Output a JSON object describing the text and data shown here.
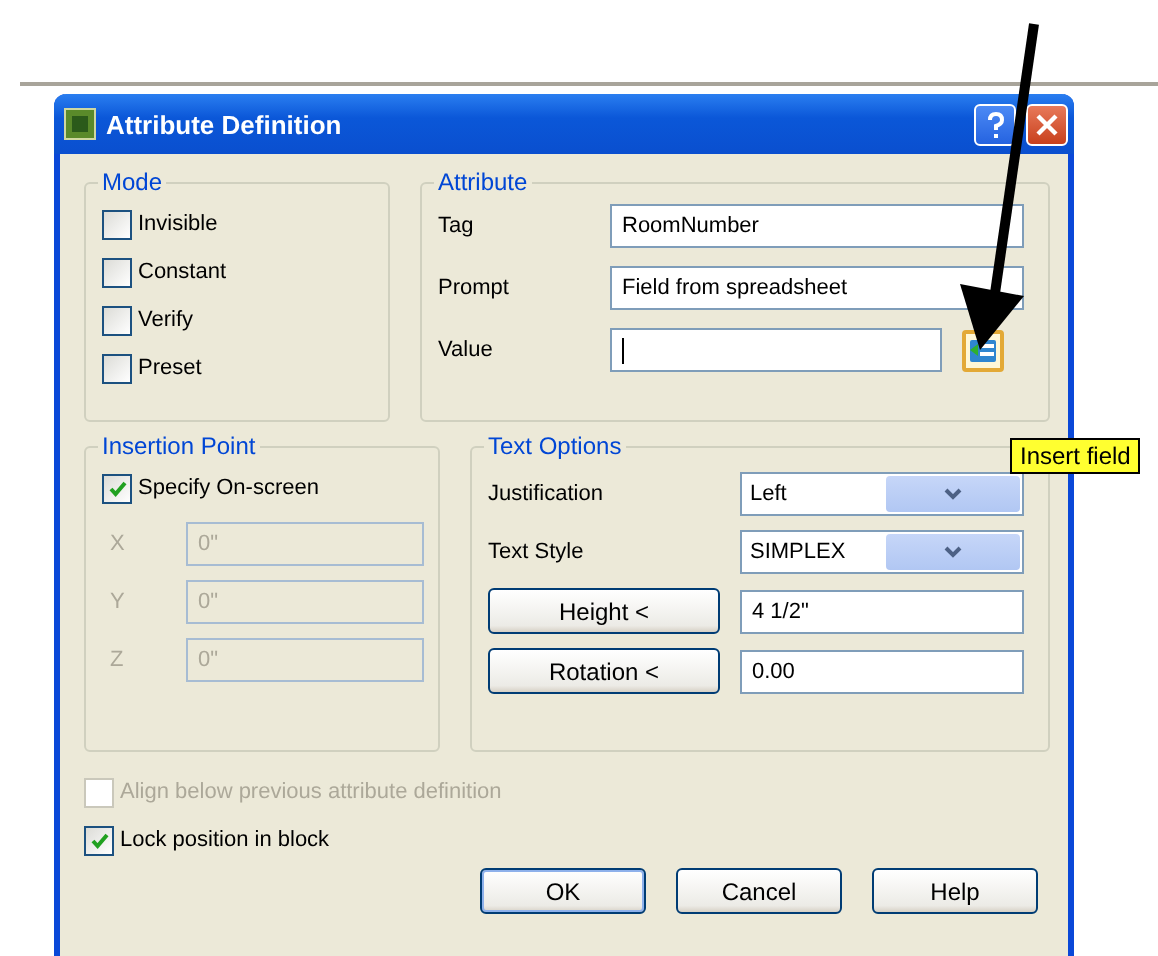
{
  "window": {
    "title": "Attribute Definition"
  },
  "mode": {
    "title": "Mode",
    "options": [
      {
        "label": "Invisible",
        "checked": false
      },
      {
        "label": "Constant",
        "checked": false
      },
      {
        "label": "Verify",
        "checked": false
      },
      {
        "label": "Preset",
        "checked": false
      }
    ]
  },
  "attribute": {
    "title": "Attribute",
    "fields": [
      {
        "label": "Tag",
        "value": "RoomNumber"
      },
      {
        "label": "Prompt",
        "value": "Field from spreadsheet"
      },
      {
        "label": "Value"
      }
    ],
    "insert_field_tooltip": "Insert field"
  },
  "insertion_point": {
    "title": "Insertion Point",
    "specify_on_screen": {
      "label": "Specify On-screen",
      "checked": true
    },
    "coords": [
      {
        "label": "X",
        "value": "0\"",
        "disabled": true
      },
      {
        "label": "Y",
        "value": "0\"",
        "disabled": true
      },
      {
        "label": "Z",
        "value": "0\"",
        "disabled": true
      }
    ]
  },
  "text_options": {
    "title": "Text Options",
    "rows": [
      {
        "kind": "dropdown",
        "label": "Justification",
        "value": "Left"
      },
      {
        "kind": "dropdown",
        "label": "Text Style",
        "value": "SIMPLEX"
      },
      {
        "kind": "pick",
        "label": "Height <",
        "value": "4 1/2\""
      },
      {
        "kind": "pick",
        "label": "Rotation <",
        "value": "0.00"
      }
    ]
  },
  "options": [
    {
      "label": "Align below previous attribute definition",
      "checked": false,
      "disabled": true
    },
    {
      "label": "Lock position in block",
      "checked": true,
      "disabled": false
    }
  ],
  "buttons": [
    "OK",
    "Cancel",
    "Help"
  ]
}
